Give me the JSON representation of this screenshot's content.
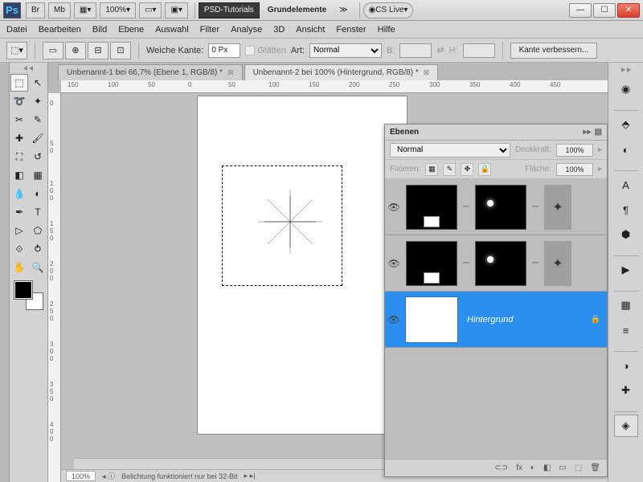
{
  "title": {
    "app": "Ps",
    "br": "Br",
    "mb": "Mb",
    "zoom": "100%",
    "workspace": "PSD-Tutorials",
    "extra": "Grundelemente",
    "cslive": "CS Live"
  },
  "menu": [
    "Datei",
    "Bearbeiten",
    "Bild",
    "Ebene",
    "Auswahl",
    "Filter",
    "Analyse",
    "3D",
    "Ansicht",
    "Fenster",
    "Hilfe"
  ],
  "opt": {
    "feather_lbl": "Weiche Kante:",
    "feather_val": "0 Px",
    "antialias": "Glätten",
    "style_lbl": "Art:",
    "style_val": "Normal",
    "w": "B:",
    "h": "H:",
    "refine": "Kante verbessern..."
  },
  "tabs": [
    {
      "label": "Unbenannt-1 bei 66,7% (Ebene 1, RGB/8) *",
      "active": false
    },
    {
      "label": "Unbenannt-2 bei 100% (Hintergrund, RGB/8) *",
      "active": true
    }
  ],
  "ruler_h": [
    "150",
    "100",
    "50",
    "0",
    "50",
    "100",
    "150",
    "200",
    "250",
    "300",
    "350",
    "400",
    "450"
  ],
  "ruler_v": [
    "0",
    "5",
    "0",
    "1",
    "0",
    "0",
    "1",
    "5",
    "0",
    "2",
    "0",
    "0",
    "2",
    "5",
    "0",
    "3",
    "0",
    "0",
    "3",
    "5",
    "0",
    "4",
    "0",
    "0"
  ],
  "layers": {
    "title": "Ebenen",
    "blend": "Normal",
    "opacity_lbl": "Deckkraft:",
    "opacity_val": "100%",
    "lock_lbl": "Fixieren:",
    "fill_lbl": "Fläche:",
    "fill_val": "100%",
    "bg_name": "Hintergrund",
    "foot": [
      "⊂⊃",
      "fx",
      "◐",
      "◧",
      "▭",
      "⬚",
      "🗑"
    ]
  },
  "status": {
    "zoom": "100%",
    "msg": "Belichtung funktioniert nur bei 32-Bit"
  }
}
